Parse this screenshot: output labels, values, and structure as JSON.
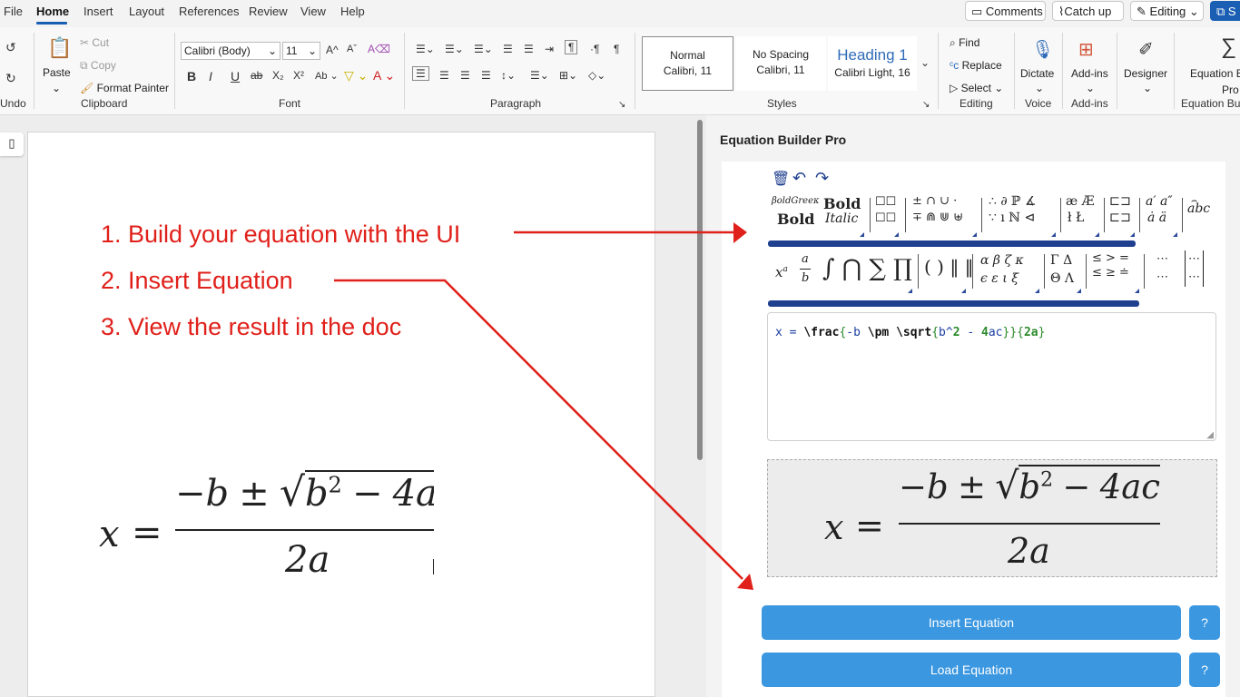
{
  "menu": {
    "items": [
      "File",
      "Home",
      "Insert",
      "Layout",
      "References",
      "Review",
      "View",
      "Help"
    ],
    "right": {
      "comments": "Comments",
      "catch_up": "Catch up",
      "editing": "Editing",
      "share": "S"
    }
  },
  "ribbon": {
    "undo_group": "Undo",
    "clipboard": {
      "paste": "Paste",
      "cut": "Cut",
      "copy": "Copy",
      "format_painter": "Format Painter",
      "label": "Clipboard"
    },
    "font": {
      "name": "Calibri (Body)",
      "size": "11",
      "label": "Font"
    },
    "paragraph": {
      "label": "Paragraph"
    },
    "styles": {
      "normal_name": "Normal",
      "normal_font": "Calibri, 11",
      "nospacing_name": "No Spacing",
      "nospacing_font": "Calibri, 11",
      "heading_name": "Heading 1",
      "heading_font": "Calibri Light, 16",
      "label": "Styles"
    },
    "editing": {
      "find": "Find",
      "replace": "Replace",
      "select": "Select",
      "label": "Editing"
    },
    "voice": {
      "dictate": "Dictate",
      "label": "Voice"
    },
    "addins": {
      "button": "Add-ins",
      "label": "Add-ins"
    },
    "designer": {
      "button": "Designer"
    },
    "equation": {
      "button_line1": "Equation B",
      "button_line2": "Pro",
      "label": "Equation Bui"
    }
  },
  "document": {
    "steps": [
      "1.  Build your equation with the UI",
      "2. Insert Equation",
      "3.  View the result in the doc"
    ]
  },
  "panel": {
    "title": "Equation Builder Pro",
    "latex": {
      "x_eq": "x = ",
      "frac": "\\frac",
      "brace1": "{",
      "minus_b": "-b ",
      "pm": "\\pm ",
      "sqrt": "\\sqrt",
      "sqrt_open": "{",
      "b2": "b^",
      "two": "2",
      "minus": " - ",
      "four": "4",
      "ac": "ac",
      "close1": "}}",
      "brace2": "{",
      "twoa": "2a",
      "close2": "}"
    },
    "palette": {
      "boldgreek": "βoldGreeκ",
      "bold": "Bold",
      "bold_serif": "Bold",
      "italic": "Italic",
      "ops1_top": "± ∩ ∪ ·",
      "ops1_bot": "∓ ⋒ ⋓ ⊎",
      "misc_top": "∴ ∂ ℙ ∡",
      "misc_bot": "∵ ı ℕ ⊲",
      "lig_top": "æ Æ",
      "lig_bot": "ł Ł",
      "prime_top": "a′ a″",
      "prime_bot": "ȧ ä",
      "widetilde": "abc",
      "sup_base": "x",
      "sup_exp": "a",
      "frac_num": "a",
      "frac_den": "b",
      "bigops": "∫ ⋂ ∑ ∏",
      "delims": "( ) ‖ ‖",
      "greek_top": "α β ζ κ",
      "greek_bot": "ϵ ε ι ξ",
      "cgreek_top": "Γ Δ",
      "cgreek_bot": "Θ Λ",
      "rel_top": "≤ > =",
      "rel_bot": "≤ ≥ ≐",
      "dots_top": "⋯",
      "dots_bot": "⋯"
    },
    "buttons": {
      "insert": "Insert Equation",
      "load": "Load Equation",
      "help": "?"
    }
  },
  "equation": {
    "lhs": "x",
    "equals": "=",
    "numerator_minus": "−",
    "b": "b",
    "pm": "±",
    "radical": "√",
    "b2_base": "b",
    "b2_exp": "2",
    "minus": "−",
    "four_ac": "4ac",
    "denominator": "2a"
  },
  "colors": {
    "accent": "#1a5fb4",
    "annotation": "#e0201a",
    "palette_bar": "#1f3f8f",
    "button": "#3b97e0"
  }
}
